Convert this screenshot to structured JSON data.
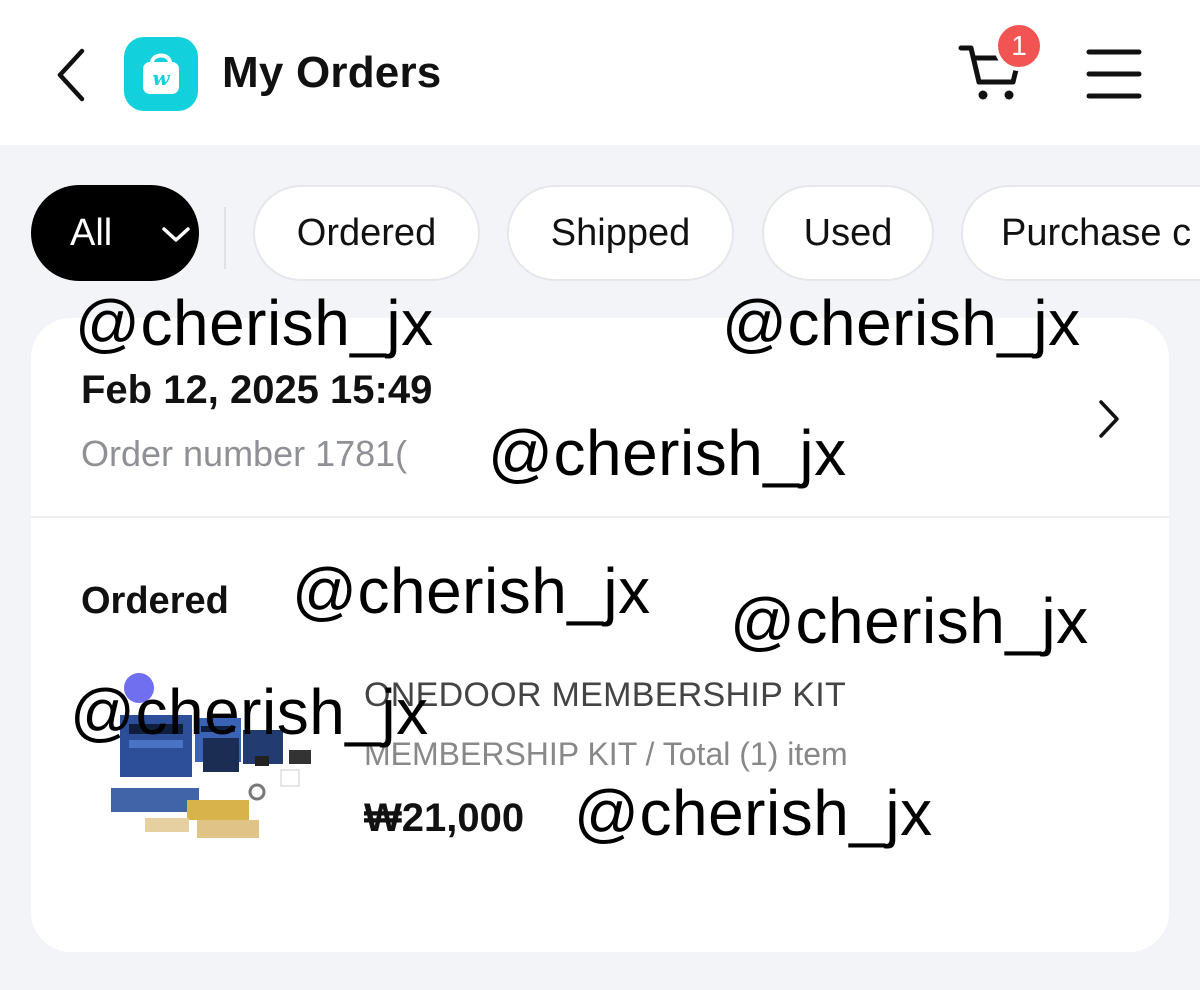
{
  "header": {
    "title": "My Orders",
    "app_logo_letter": "w",
    "cart_count": "1",
    "icons": [
      "chevron-left-icon",
      "shopping-bag-icon",
      "cart-icon",
      "hamburger-menu-icon"
    ]
  },
  "filters": {
    "items": [
      {
        "label": "All",
        "selected": true
      },
      {
        "label": "Ordered"
      },
      {
        "label": "Shipped"
      },
      {
        "label": "Used"
      },
      {
        "label": "Purchase c"
      }
    ]
  },
  "order": {
    "date": "Feb 12, 2025 15:49",
    "number_text": "Order number 1781(",
    "status": "Ordered",
    "product": {
      "name": "ONEDOOR MEMBERSHIP KIT",
      "option": "MEMBERSHIP KIT / Total (1) item",
      "price": "₩21,000"
    }
  },
  "watermark": "@cherish_jx",
  "colors": {
    "brand": "#12d0dc",
    "badge": "#f25454",
    "background": "#f3f4f7",
    "selected_chip": "#000000"
  }
}
